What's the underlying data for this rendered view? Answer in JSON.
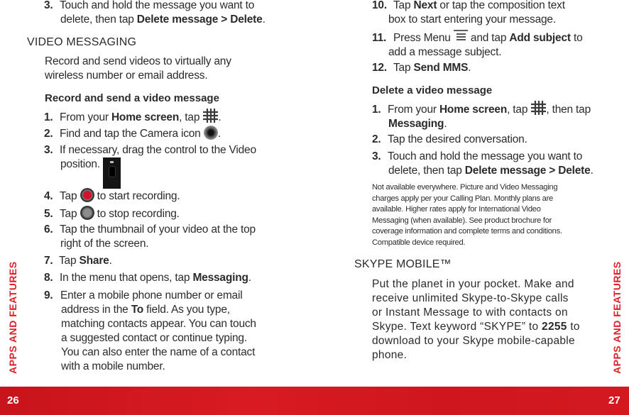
{
  "left_page": {
    "page_number": "26",
    "side_tab": "APPS AND FEATURES",
    "carry_step": {
      "num": "3.",
      "text_a": "Touch and hold the message you want to",
      "text_b": "delete, then tap ",
      "bold": "Delete message > Delete",
      "end": "."
    },
    "section_title": "VIDEO MESSAGING",
    "intro_line1": "Record and send videos to virtually any",
    "intro_line2": "wireless number or email address.",
    "subhead": "Record and send a video message",
    "steps": [
      {
        "num": "1.",
        "pre": "From your ",
        "bold": "Home screen",
        "post": ", tap",
        "icon": "apps-grid-icon",
        "end": "."
      },
      {
        "num": "2.",
        "pre": "Find and tap the Camera icon",
        "icon": "camera-icon",
        "end": "."
      },
      {
        "num": "3.",
        "line1": "If necessary, drag the control to the Video",
        "line2": "position.",
        "icon": "camera-video-slider-icon"
      },
      {
        "num": "4.",
        "pre": "Tap",
        "icon": "record-button-icon",
        "post": "to start recording."
      },
      {
        "num": "5.",
        "pre": "Tap",
        "icon": "stop-button-icon",
        "post": "to stop recording."
      },
      {
        "num": "6.",
        "line1": "Tap the thumbnail of your video at the top",
        "line2": "right of the screen."
      },
      {
        "num": "7.",
        "pre": "Tap ",
        "bold": "Share",
        "end": "."
      },
      {
        "num": "8.",
        "pre": "In the menu that opens, tap ",
        "bold": "Messaging",
        "end": "."
      },
      {
        "num": "9.",
        "line1": "Enter a mobile phone number or email",
        "line2_pre": "address in the ",
        "line2_bold": "To",
        "line2_post": " field. As you type,",
        "line3": "matching contacts appear. You can touch",
        "line4": "a suggested contact or continue typing.",
        "line5": "You can also enter the name of a contact",
        "line6": "with a mobile number."
      }
    ]
  },
  "right_page": {
    "page_number": "27",
    "side_tab": "APPS AND FEATURES",
    "steps": [
      {
        "num": "10.",
        "pre": "Tap ",
        "bold": "Next",
        "post": " or tap the composition text",
        "line2": "box to start entering your message."
      },
      {
        "num": "11.",
        "pre": "Press Menu",
        "icon": "menu-icon",
        "mid": "and tap ",
        "bold": "Add subject",
        "post": " to",
        "line2": "add a message subject."
      },
      {
        "num": "12.",
        "pre": "Tap ",
        "bold": "Send MMS",
        "end": "."
      }
    ],
    "subhead": "Delete a video message",
    "delete_steps": [
      {
        "num": "1.",
        "pre": "From your ",
        "bold": "Home screen",
        "post": ", tap",
        "icon": "apps-grid-icon",
        "post2": ", then tap",
        "line2_bold": "Messaging",
        "line2_end": "."
      },
      {
        "num": "2.",
        "text": "Tap the desired conversation."
      },
      {
        "num": "3.",
        "line1": "Touch and hold the message you want to",
        "line2_pre": "delete, then tap ",
        "line2_bold": "Delete message > Delete",
        "line2_end": "."
      }
    ],
    "disclaimer": [
      "Not available everywhere. Picture and Video Messaging",
      "charges apply per your Calling Plan. Monthly plans are",
      "available. Higher rates apply for International Video",
      "Messaging (when available). See product brochure for",
      "coverage information and complete terms and conditions.",
      "Compatible device required."
    ],
    "section_title": "SKYPE MOBILE™",
    "skype_lines": [
      "Put the planet in your pocket. Make and",
      "receive unlimited Skype-to-Skype calls",
      "or Instant Message to with contacts on"
    ],
    "skype_line4_pre": "Skype. Text keyword “SKYPE” to ",
    "skype_line4_bold": "2255",
    "skype_line4_post": " to",
    "skype_line5": "download to your Skype mobile-capable",
    "skype_line6": "phone."
  },
  "colors": {
    "accent_red": "#d91a22",
    "text": "#2b2b2b"
  }
}
